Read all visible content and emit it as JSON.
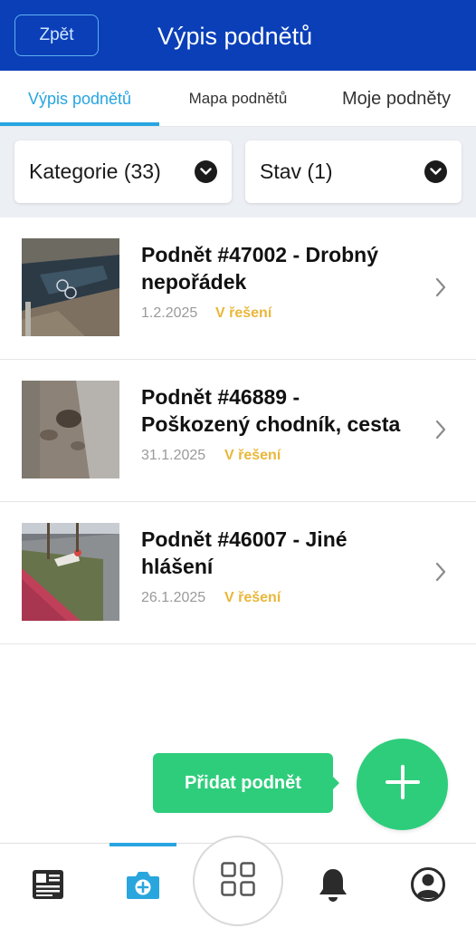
{
  "header": {
    "back_label": "Zpět",
    "title": "Výpis podnětů"
  },
  "tabs": [
    {
      "label": "Výpis podnětů",
      "active": true
    },
    {
      "label": "Mapa podnětů",
      "active": false
    },
    {
      "label": "Moje podněty",
      "active": false
    }
  ],
  "filters": {
    "category_label": "Kategorie (33)",
    "status_label": "Stav (1)"
  },
  "items": [
    {
      "title": "Podnět  #47002 - Drobný nepořádek",
      "date": "1.2.2025",
      "status": "V řešení"
    },
    {
      "title": "Podnět  #46889 - Poškozený chodník, cesta",
      "date": "31.1.2025",
      "status": "V řešení"
    },
    {
      "title": "Podnět  #46007 - Jiné hlášení",
      "date": "26.1.2025",
      "status": "V řešení"
    }
  ],
  "add_button_label": "Přidat podnět",
  "bottom_nav": [
    {
      "icon": "news-icon",
      "active": false
    },
    {
      "icon": "camera-add-icon",
      "active": true
    },
    {
      "icon": "grid-icon",
      "active": false
    },
    {
      "icon": "bell-icon",
      "active": false
    },
    {
      "icon": "user-icon",
      "active": false
    }
  ],
  "colors": {
    "header": "#0a3fb8",
    "accent": "#27a5e0",
    "add": "#2ecd7b",
    "status": "#e9b73a"
  }
}
